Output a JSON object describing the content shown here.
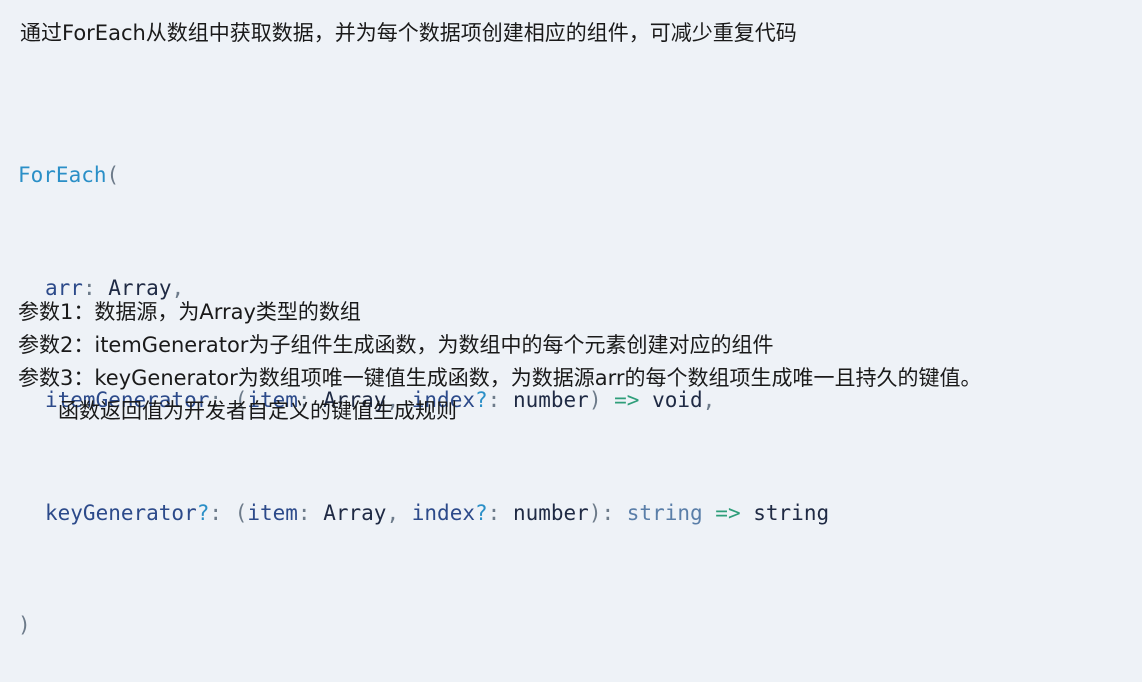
{
  "intro": "通过ForEach从数组中获取数据，并为每个数据项创建相应的组件，可减少重复代码",
  "code": {
    "fn": "ForEach",
    "open": "(",
    "close": ")",
    "arr_param": "arr",
    "arr_type": "Array",
    "item_param": "itemGenerator",
    "key_param": "keyGenerator",
    "q_mark": "?",
    "colon": ":",
    "comma": ",",
    "item_arg": "item",
    "index_arg": "index",
    "number_type": "number",
    "arrow": "=>",
    "void_type": "void",
    "string_type": "string"
  },
  "params": [
    "参数1：数据源，为Array类型的数组",
    "参数2：itemGenerator为子组件生成函数，为数组中的每个元素创建对应的组件",
    "参数3：keyGenerator为数组项唯一键值生成函数，为数据源arr的每个数组项生成唯一且持久的键值。",
    "函数返回值为开发者自定义的键值生成规则"
  ]
}
